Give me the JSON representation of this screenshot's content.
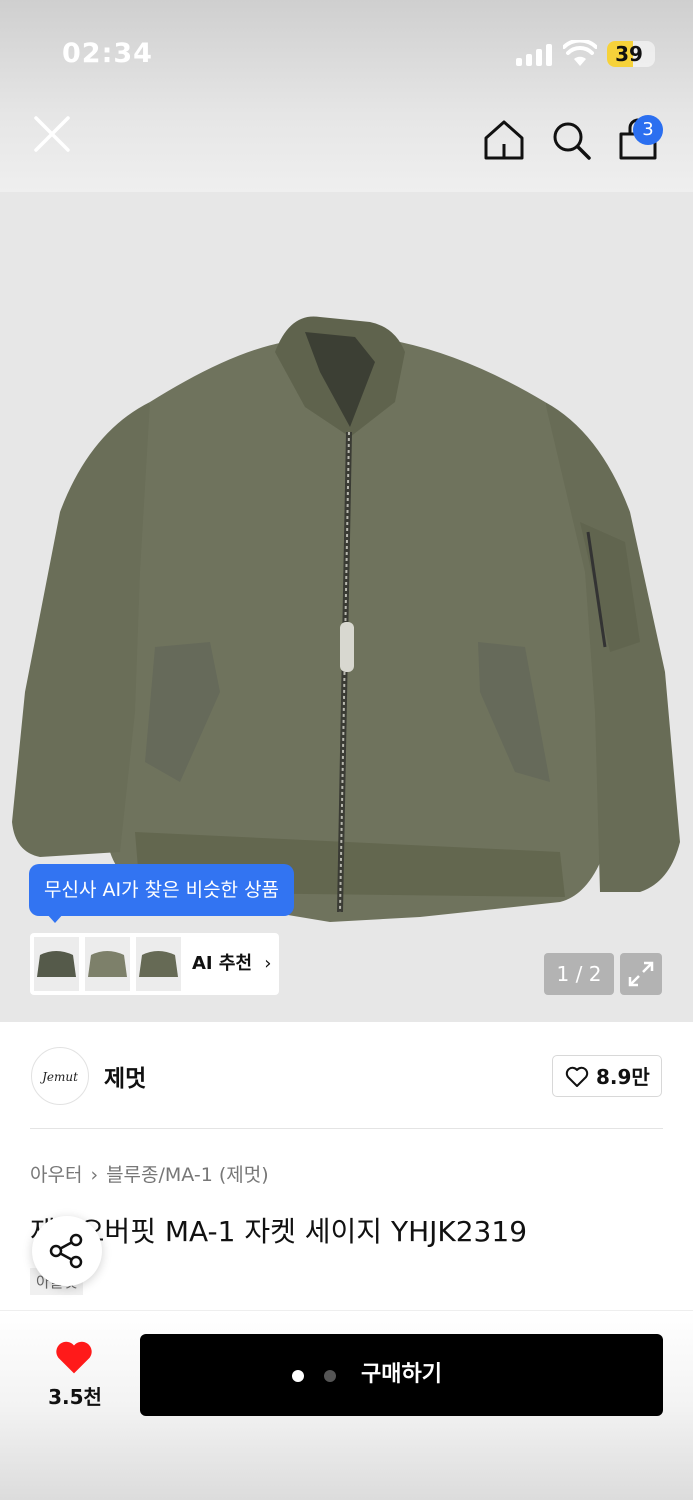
{
  "status_bar": {
    "time": "02:34",
    "battery": "39"
  },
  "nav": {
    "cart_count": "3",
    "icons": [
      "close-icon",
      "home-icon",
      "search-icon",
      "shopping-bag-icon"
    ]
  },
  "gallery": {
    "counter": "1 / 2",
    "ai_tooltip": "무신사 AI가 찾은 비슷한 상품",
    "ai_label": "AI 추천"
  },
  "brand": {
    "logo_text": "Jemut",
    "name": "제멋",
    "likes": "8.9만"
  },
  "breadcrumb": [
    "아우터",
    "블루종/MA-1 (제멋)"
  ],
  "product": {
    "title_prefix": "제",
    "title": "오버핏 MA-1 자켓 세이지 YHJK2319",
    "tag": "아울렛"
  },
  "bottom": {
    "wish_count": "3.5천",
    "buy_label": "구매하기"
  },
  "colors": {
    "accent_blue": "#3274f2",
    "heart_red": "#ff1a1a",
    "jacket": "#6f735d"
  }
}
